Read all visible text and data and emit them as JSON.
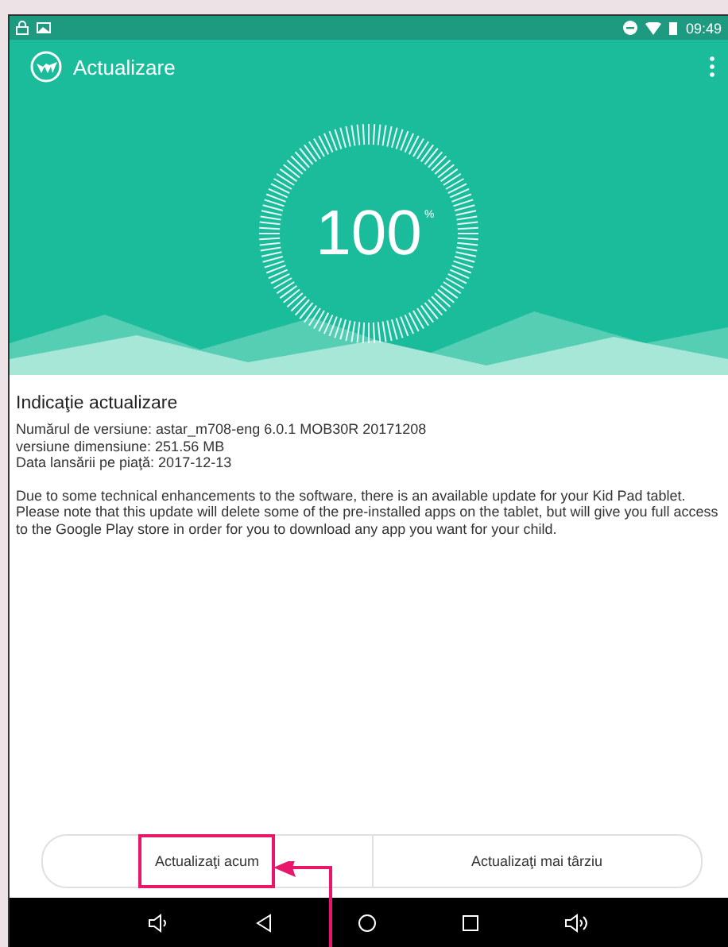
{
  "status_bar": {
    "time": "09:49"
  },
  "toolbar": {
    "title": "Actualizare"
  },
  "progress": {
    "reading": "100",
    "unit": "%"
  },
  "info": {
    "heading": "Indicaţie actualizare",
    "lines": [
      "Numărul de versiune: astar_m708-eng 6.0.1 MOB30R 20171208",
      "versiune dimensiune: 251.56 MB",
      "Data lansării pe piaţă: 2017-12-13"
    ],
    "description": "Due to some technical enhancements to the software, there is an available update for your Kid Pad tablet. Please note that this update will delete some of the pre-installed apps on the tablet, but will give you full access to the Google Play store in order for you to download any app you want for your child."
  },
  "buttons": [
    {
      "label": "Actualizaţi acum",
      "highlighted": true
    },
    {
      "label": "Actualizaţi mai târziu",
      "highlighted": false
    }
  ]
}
